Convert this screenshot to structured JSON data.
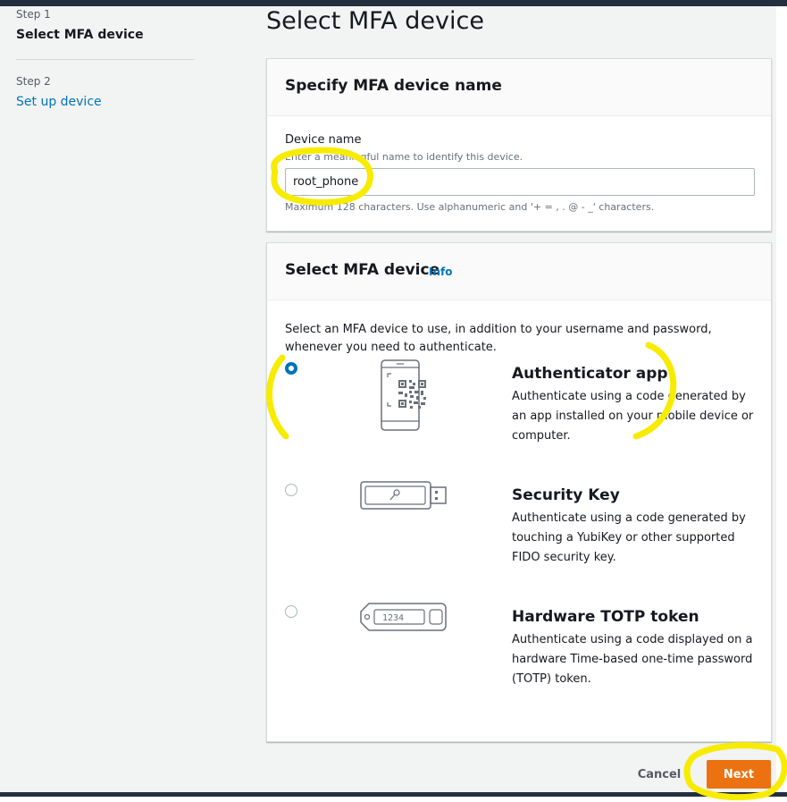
{
  "steps": [
    {
      "label": "Step 1",
      "title": "Select MFA device"
    },
    {
      "label": "Step 2",
      "title": "Set up device"
    }
  ],
  "page_title": "Select MFA device",
  "name_panel": {
    "title": "Specify MFA device name",
    "field_label": "Device name",
    "field_description": "Enter a meaningful name to identify this device.",
    "field_value": "root_phone",
    "field_constraint": "Maximum 128 characters. Use alphanumeric and '+ = , . @ - _' characters."
  },
  "device_panel": {
    "title": "Select MFA device",
    "info_label": "Info",
    "intro": "Select an MFA device to use, in addition to your username and password, whenever you need to authenticate.",
    "options": [
      {
        "title": "Authenticator app",
        "description": "Authenticate using a code generated by an app installed on your mobile device or computer.",
        "selected": true,
        "icon": "phone-qr-icon"
      },
      {
        "title": "Security Key",
        "description": "Authenticate using a code generated by touching a YubiKey or other supported FIDO security key.",
        "selected": false,
        "icon": "usb-key-icon"
      },
      {
        "title": "Hardware TOTP token",
        "description": "Authenticate using a code displayed on a hardware Time-based one-time password (TOTP) token.",
        "selected": false,
        "icon": "totp-token-icon",
        "token_display": "1234"
      }
    ]
  },
  "actions": {
    "cancel_label": "Cancel",
    "next_label": "Next"
  },
  "colors": {
    "primary_button": "#ec7211",
    "link": "#0073bb",
    "selected_radio": "#0073bb",
    "annotation_highlight": "#f7ec00",
    "header_bar": "#232f3e"
  }
}
